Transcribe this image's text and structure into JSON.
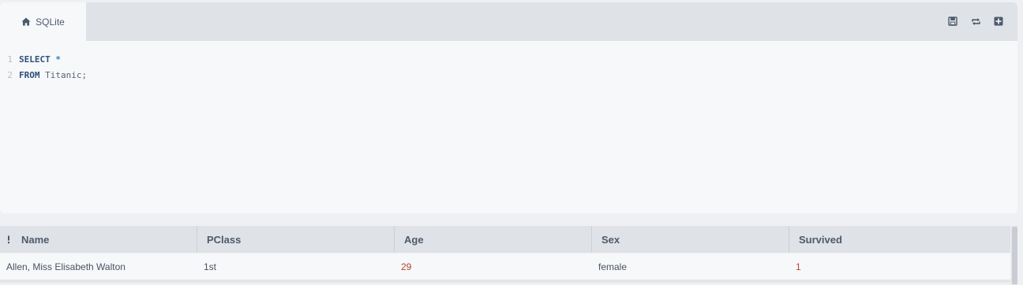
{
  "editor": {
    "tab": {
      "label": "SQLite",
      "icon": "home-icon"
    },
    "toolbar": [
      {
        "name": "save-icon",
        "title": "Save"
      },
      {
        "name": "refresh-icon",
        "title": "Refresh"
      },
      {
        "name": "add-icon",
        "title": "Add"
      }
    ],
    "code": [
      {
        "num": "1",
        "kw": "SELECT",
        "rest": "*"
      },
      {
        "num": "2",
        "kw": "FROM",
        "rest": "Titanic;"
      }
    ]
  },
  "results": {
    "menu_icon": "kebab-icon",
    "columns": [
      "Name",
      "PClass",
      "Age",
      "Sex",
      "Survived"
    ],
    "rows": [
      [
        "Allen, Miss Elisabeth Walton",
        "1st",
        "29",
        "female",
        "1"
      ]
    ]
  },
  "colors": {
    "accent": "#2f7fc4",
    "number": "#b0462e",
    "keyword": "#2e4f7a"
  }
}
